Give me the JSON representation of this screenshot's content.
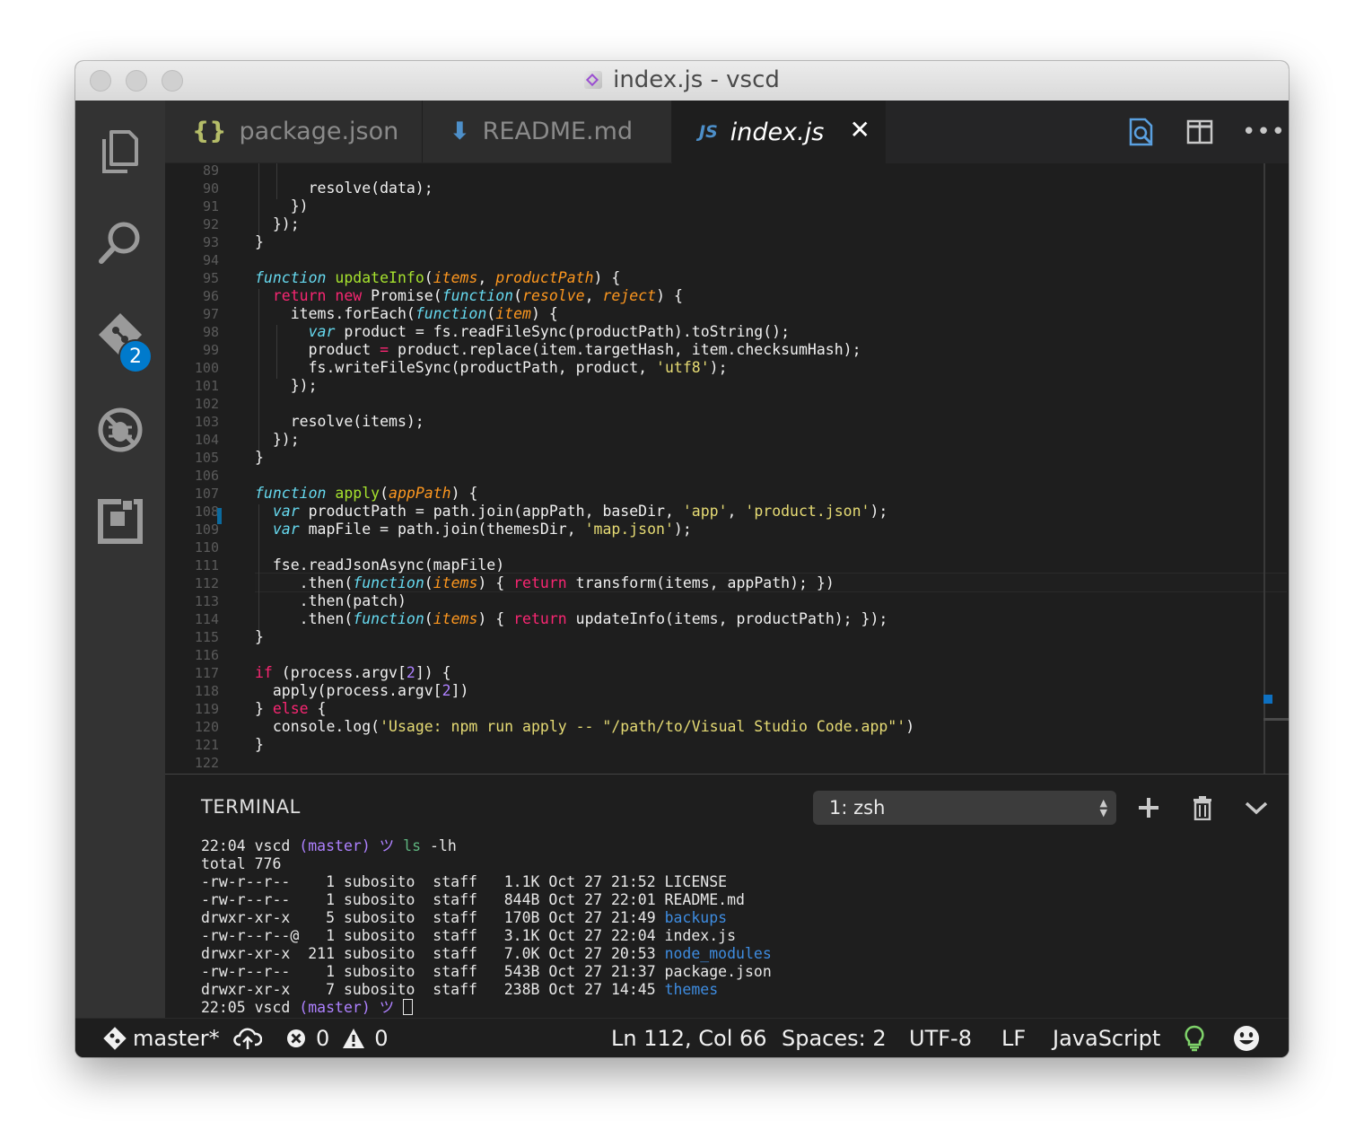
{
  "window": {
    "title": "index.js - vscd"
  },
  "activity_bar": {
    "scm_badge": "2"
  },
  "tabs": [
    {
      "label": "package.json",
      "icon_text": "{}",
      "icon": "json-braces-icon",
      "active": false
    },
    {
      "label": "README.md",
      "icon_text": "⬇",
      "icon": "markdown-arrow-icon",
      "active": false
    },
    {
      "label": "index.js",
      "icon_text": "JS",
      "icon": "js-icon",
      "active": true
    }
  ],
  "colors": {
    "keyword": "#f92672",
    "storage": "#66d9ef",
    "function_name": "#a6e22e",
    "param": "#fd971f",
    "string": "#e6db74",
    "number": "#ae81ff",
    "accent": "#007acc"
  },
  "editor": {
    "line_numbers": [
      "89",
      "90",
      "91",
      "92",
      "93",
      "94",
      "95",
      "96",
      "97",
      "98",
      "99",
      "100",
      "101",
      "102",
      "103",
      "104",
      "105",
      "106",
      "107",
      "108",
      "109",
      "110",
      "111",
      "112",
      "113",
      "114",
      "115",
      "116",
      "117",
      "118",
      "119",
      "120",
      "121",
      "122"
    ],
    "lines": [
      [],
      [
        {
          "t": "      resolve(data);"
        }
      ],
      [
        {
          "t": "    })"
        }
      ],
      [
        {
          "t": "  });"
        }
      ],
      [
        {
          "t": "}"
        }
      ],
      [],
      [
        {
          "t": "function",
          "c": "fn"
        },
        {
          "t": " "
        },
        {
          "t": "updateInfo",
          "c": "nm"
        },
        {
          "t": "("
        },
        {
          "t": "items",
          "c": "pa"
        },
        {
          "t": ", "
        },
        {
          "t": "productPath",
          "c": "pa"
        },
        {
          "t": ") {"
        }
      ],
      [
        {
          "t": "  "
        },
        {
          "t": "return",
          "c": "kw"
        },
        {
          "t": " "
        },
        {
          "t": "new",
          "c": "kw"
        },
        {
          "t": " Promise("
        },
        {
          "t": "function",
          "c": "fn"
        },
        {
          "t": "("
        },
        {
          "t": "resolve",
          "c": "pa"
        },
        {
          "t": ", "
        },
        {
          "t": "reject",
          "c": "pa"
        },
        {
          "t": ") {"
        }
      ],
      [
        {
          "t": "    items.forEach("
        },
        {
          "t": "function",
          "c": "fn"
        },
        {
          "t": "("
        },
        {
          "t": "item",
          "c": "pa"
        },
        {
          "t": ") {"
        }
      ],
      [
        {
          "t": "      "
        },
        {
          "t": "var",
          "c": "fn"
        },
        {
          "t": " product = fs.readFileSync(productPath).toString();"
        }
      ],
      [
        {
          "t": "      product "
        },
        {
          "t": "=",
          "c": "kw"
        },
        {
          "t": " product.replace(item.targetHash, item.checksumHash);"
        }
      ],
      [
        {
          "t": "      fs.writeFileSync(productPath, product, "
        },
        {
          "t": "'utf8'",
          "c": "st"
        },
        {
          "t": ");"
        }
      ],
      [
        {
          "t": "    });"
        }
      ],
      [],
      [
        {
          "t": "    resolve(items);"
        }
      ],
      [
        {
          "t": "  });"
        }
      ],
      [
        {
          "t": "}"
        }
      ],
      [],
      [
        {
          "t": "function",
          "c": "fn"
        },
        {
          "t": " "
        },
        {
          "t": "apply",
          "c": "nm"
        },
        {
          "t": "("
        },
        {
          "t": "appPath",
          "c": "pa"
        },
        {
          "t": ") {"
        }
      ],
      [
        {
          "t": "  "
        },
        {
          "t": "var",
          "c": "fn"
        },
        {
          "t": " productPath = path.join(appPath, baseDir, "
        },
        {
          "t": "'app'",
          "c": "st"
        },
        {
          "t": ", "
        },
        {
          "t": "'product.json'",
          "c": "st"
        },
        {
          "t": ");"
        }
      ],
      [
        {
          "t": "  "
        },
        {
          "t": "var",
          "c": "fn"
        },
        {
          "t": " mapFile = path.join(themesDir, "
        },
        {
          "t": "'map.json'",
          "c": "st"
        },
        {
          "t": ");"
        }
      ],
      [],
      [
        {
          "t": "  fse.readJsonAsync(mapFile)"
        }
      ],
      [
        {
          "t": "     .then("
        },
        {
          "t": "function",
          "c": "fn"
        },
        {
          "t": "("
        },
        {
          "t": "items",
          "c": "pa"
        },
        {
          "t": ") { "
        },
        {
          "t": "return",
          "c": "kw"
        },
        {
          "t": " transform(items, appPath); })"
        }
      ],
      [
        {
          "t": "     .then(patch)"
        }
      ],
      [
        {
          "t": "     .then("
        },
        {
          "t": "function",
          "c": "fn"
        },
        {
          "t": "("
        },
        {
          "t": "items",
          "c": "pa"
        },
        {
          "t": ") { "
        },
        {
          "t": "return",
          "c": "kw"
        },
        {
          "t": " updateInfo(items, productPath); });"
        }
      ],
      [
        {
          "t": "}"
        }
      ],
      [],
      [
        {
          "t": "if",
          "c": "kw"
        },
        {
          "t": " (process.argv["
        },
        {
          "t": "2",
          "c": "nu"
        },
        {
          "t": "]) {"
        }
      ],
      [
        {
          "t": "  apply(process.argv["
        },
        {
          "t": "2",
          "c": "nu"
        },
        {
          "t": "])"
        }
      ],
      [
        {
          "t": "} "
        },
        {
          "t": "else",
          "c": "kw"
        },
        {
          "t": " {"
        }
      ],
      [
        {
          "t": "  console.log("
        },
        {
          "t": "'Usage: npm run apply -- \"/path/to/Visual Studio Code.app\"'",
          "c": "st"
        },
        {
          "t": ")"
        }
      ],
      [
        {
          "t": "}"
        }
      ],
      []
    ]
  },
  "panel": {
    "title": "TERMINAL",
    "terminal_select": "1: zsh",
    "lines": [
      [
        {
          "t": "22:04 vscd "
        },
        {
          "t": "(master)",
          "c": "tpurple"
        },
        {
          "t": " ツ ",
          "c": "tpurple"
        },
        {
          "t": "ls",
          "c": "tgreen"
        },
        {
          "t": " -lh"
        }
      ],
      [
        {
          "t": "total 776"
        }
      ],
      [
        {
          "t": "-rw-r--r--    1 subosito  staff   1.1K Oct 27 21:52 LICENSE"
        }
      ],
      [
        {
          "t": "-rw-r--r--    1 subosito  staff   844B Oct 27 22:01 README.md"
        }
      ],
      [
        {
          "t": "drwxr-xr-x    5 subosito  staff   170B Oct 27 21:49 "
        },
        {
          "t": "backups",
          "c": "tblue"
        }
      ],
      [
        {
          "t": "-rw-r--r--@   1 subosito  staff   3.1K Oct 27 22:04 index.js"
        }
      ],
      [
        {
          "t": "drwxr-xr-x  211 subosito  staff   7.0K Oct 27 20:53 "
        },
        {
          "t": "node_modules",
          "c": "tblue"
        }
      ],
      [
        {
          "t": "-rw-r--r--    1 subosito  staff   543B Oct 27 21:37 package.json"
        }
      ],
      [
        {
          "t": "drwxr-xr-x    7 subosito  staff   238B Oct 27 14:45 "
        },
        {
          "t": "themes",
          "c": "tblue"
        }
      ],
      [
        {
          "t": "22:05 vscd "
        },
        {
          "t": "(master)",
          "c": "tpurple"
        },
        {
          "t": " ツ ",
          "c": "tpurple"
        }
      ]
    ]
  },
  "status": {
    "branch": "master*",
    "errors": "0",
    "warnings": "0",
    "position": "Ln 112, Col 66",
    "spaces": "Spaces: 2",
    "encoding": "UTF-8",
    "eol": "LF",
    "language": "JavaScript"
  }
}
